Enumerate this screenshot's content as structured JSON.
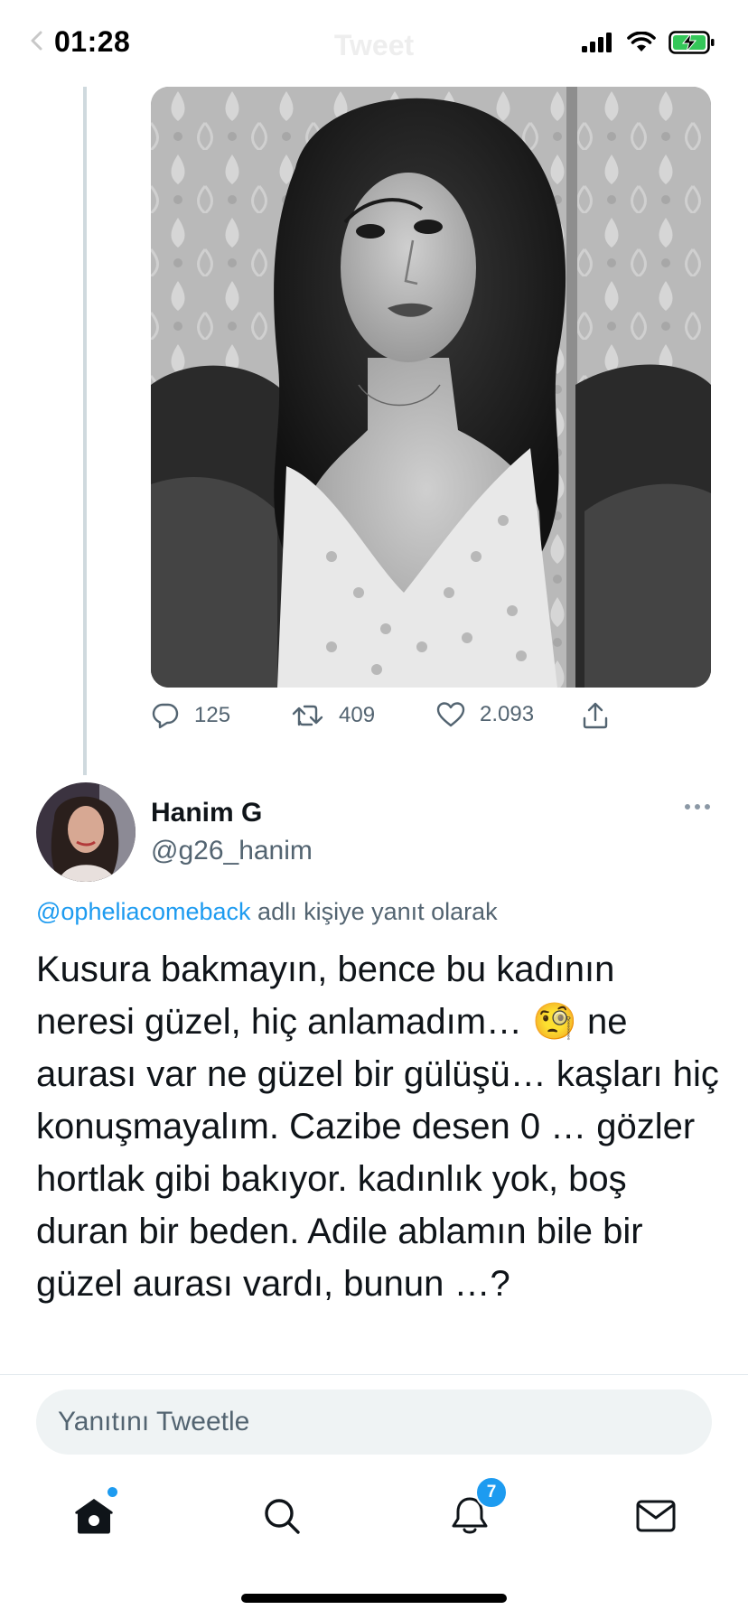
{
  "status_bar": {
    "time": "01:28",
    "nav_title": "Tweet"
  },
  "icons": {
    "back": "chevron-left-icon",
    "signal": "cellular-signal-icon",
    "wifi": "wifi-icon",
    "battery": "battery-charging-icon",
    "reply": "reply-bubble-icon",
    "retweet": "retweet-icon",
    "like": "heart-icon",
    "share": "share-icon",
    "home": "home-icon",
    "search": "search-icon",
    "notifications": "bell-icon",
    "messages": "envelope-icon"
  },
  "parent_tweet": {
    "photo_description": "Black and white photo",
    "stats": {
      "replies": "125",
      "retweets": "409",
      "likes": "2.093"
    }
  },
  "reply": {
    "display_name": "Hanim G",
    "handle": "@g26_hanim",
    "reply_to_mention": "@opheliacomeback",
    "reply_to_suffix": " adlı kişiye yanıt olarak",
    "text": "Kusura bakmayın, bence bu kadının neresi güzel, hiç anlamadım… 🧐 ne aurası var ne güzel bir gülüşü… kaşları hiç konuşmayalım. Cazibe desen 0 … gözler hortlak gibi bakıyor. kadınlık yok, boş duran bir beden. Adile ablamın bile bir güzel aurası vardı, bunun …?"
  },
  "composer": {
    "placeholder": "Yanıtını Tweetle"
  },
  "tab_bar": {
    "notification_count": "7"
  },
  "colors": {
    "accent": "#1d9bf0",
    "secondary_text": "#536471",
    "primary_text": "#0f1419",
    "battery_green": "#34c759"
  }
}
